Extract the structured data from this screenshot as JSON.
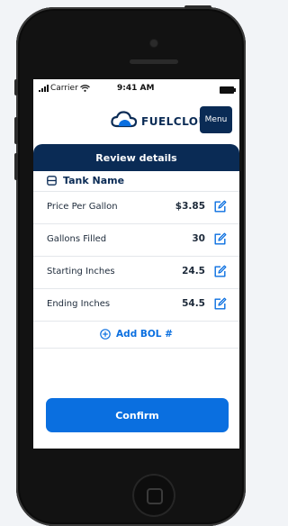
{
  "status_bar": {
    "carrier": "Carrier",
    "time": "9:41 AM"
  },
  "header": {
    "brand": "FUELCLOUD",
    "menu_label": "Menu"
  },
  "panel": {
    "title": "Review details",
    "tank_name": "Tank Name",
    "fields": [
      {
        "label": "Price Per Gallon",
        "value": "$3.85"
      },
      {
        "label": "Gallons Filled",
        "value": "30"
      },
      {
        "label": "Starting Inches",
        "value": "24.5"
      },
      {
        "label": "Ending Inches",
        "value": "54.5"
      }
    ],
    "add_bol_label": "Add BOL #",
    "confirm_label": "Confirm"
  },
  "colors": {
    "navy": "#0a2b55",
    "accent_blue": "#0a6fe0",
    "white": "#ffffff"
  },
  "icons": [
    "signal-icon",
    "wifi-icon",
    "battery-icon",
    "cloud-logo-icon",
    "tank-icon",
    "edit-icon",
    "add-circle-icon",
    "home-button-icon"
  ]
}
